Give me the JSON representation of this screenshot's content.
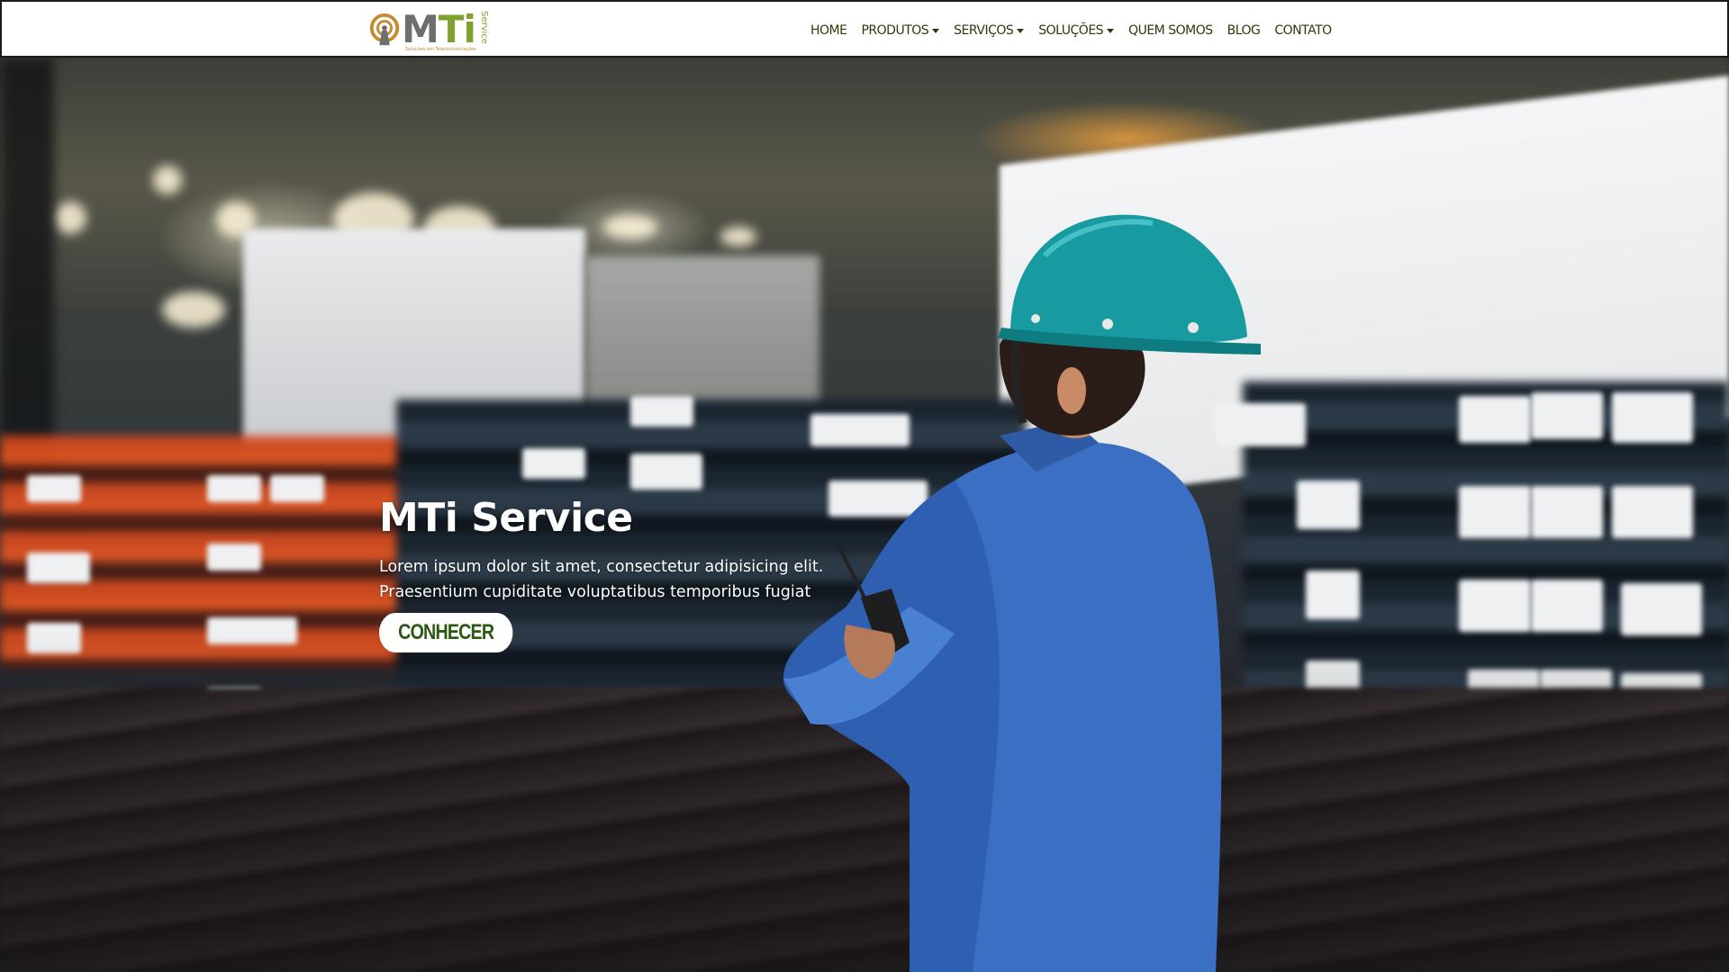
{
  "header": {
    "logo": {
      "word_main": "MTi",
      "word_m": "M",
      "word_ti": "Ti",
      "vertical_text": "Service",
      "tagline": "Soluções em Telecomunicações",
      "icon": "broadcast-tower-icon"
    },
    "nav": [
      {
        "label": "HOME",
        "dropdown": false
      },
      {
        "label": "PRODUTOS",
        "dropdown": true
      },
      {
        "label": "SERVIÇOS",
        "dropdown": true
      },
      {
        "label": "SOLUÇÕES",
        "dropdown": true
      },
      {
        "label": "QUEM SOMOS",
        "dropdown": false
      },
      {
        "label": "BLOG",
        "dropdown": false
      },
      {
        "label": "CONTATO",
        "dropdown": false
      }
    ]
  },
  "hero": {
    "title": "MTi Service",
    "description_line1": "Lorem ipsum dolor sit amet, consectetur adipisicing elit.",
    "description_line2": "Praesentium cupiditate voluptatibus temporibus fugiat",
    "button_label": "CONHECER",
    "background": "industrial-warehouse-worker-photo"
  },
  "colors": {
    "nav_text": "#2b3a0c",
    "logo_grey": "#6e6e6e",
    "logo_green": "#7fa12e",
    "logo_orange": "#c7892e",
    "button_text": "#2a5a12",
    "button_bg": "#ffffff",
    "hero_text": "#ffffff",
    "helmet": "#179aa0",
    "uniform": "#3a6fc4"
  }
}
